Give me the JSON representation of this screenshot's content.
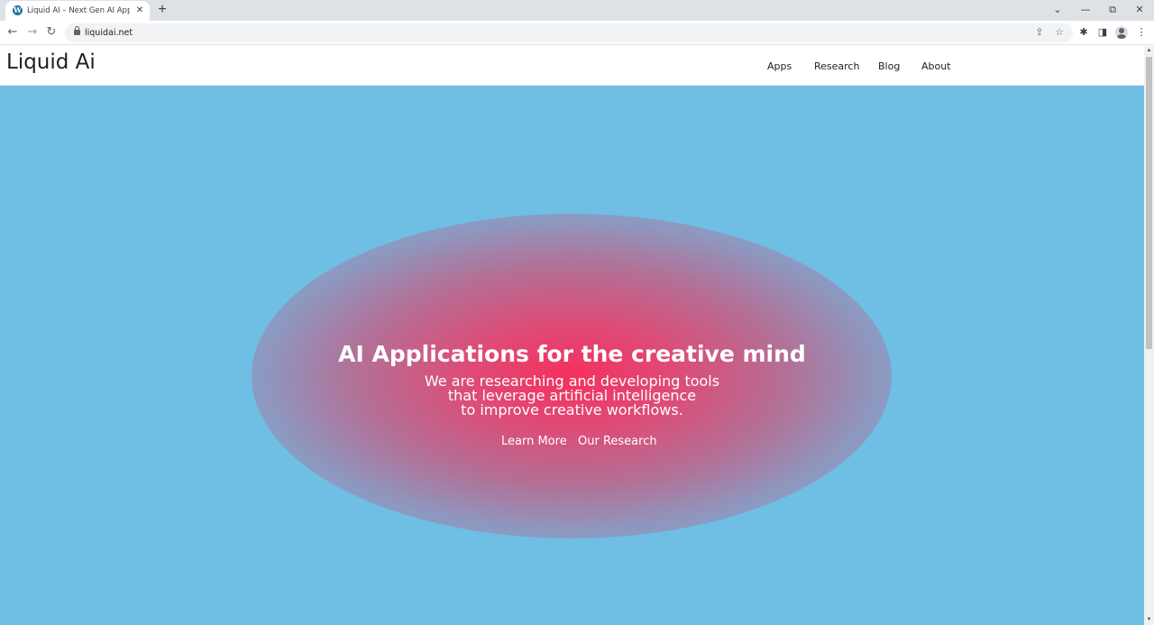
{
  "browser": {
    "tab_title": "Liquid AI – Next Gen AI Applications",
    "tab_favicon": "wordpress-icon",
    "tab_close": "✕",
    "new_tab": "+",
    "url": "liquidai.net",
    "window_controls": {
      "list": "⌄",
      "minimize": "—",
      "restore": "⧉",
      "close": "✕"
    },
    "nav": {
      "back": "←",
      "forward": "→",
      "reload": "↻"
    },
    "icons": {
      "share": "⇪",
      "bookmark": "☆",
      "extensions": "✱",
      "sidebar": "◨",
      "menu": "⋮"
    }
  },
  "site": {
    "title": "Liquid Ai",
    "nav": [
      "Apps",
      "Research",
      "Blog",
      "About"
    ]
  },
  "hero": {
    "title": "AI Applications for the creative mind",
    "subtitle_lines": [
      "We are researching and developing tools",
      "that leverage artificial intelligence",
      "to improve creative workflows."
    ],
    "links": [
      "Learn More",
      "Our Research"
    ],
    "colors": {
      "background": "#6fbfe4",
      "glow": "#f5305e"
    }
  }
}
